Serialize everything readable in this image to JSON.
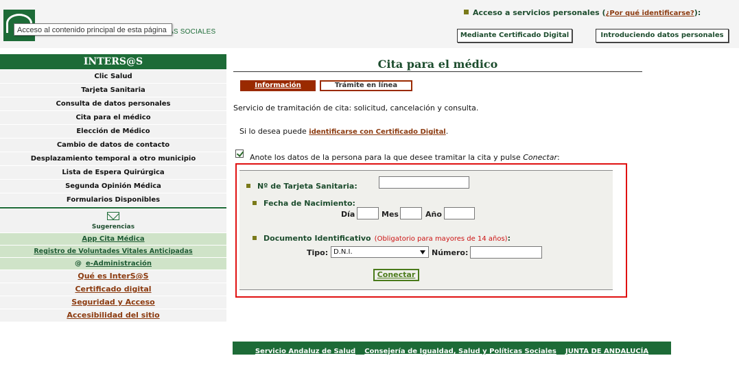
{
  "header": {
    "logo_text": "AS SOCIALES",
    "tooltip": "Acceso al contenido principal de esta página",
    "access_text": "Acceso a servicios personales",
    "access_link": "¿Por qué identificarse?",
    "access_paren_open": "(",
    "access_paren_close": "):",
    "btn_cert": "Mediante Certificado Digital",
    "btn_datos": "Introduciendo datos personales"
  },
  "sidebar": {
    "title": "INTERS@S",
    "items": [
      "Clic Salud",
      "Tarjeta Sanitaria",
      "Consulta de datos personales",
      "Cita para el médico",
      "Elección de Médico",
      "Cambio de datos de contacto",
      "Desplazamiento temporal a otro municipio",
      "Lista de Espera Quirúrgica",
      "Segunda Opinión Médica",
      "Formularios Disponibles"
    ],
    "sugerencias": "Sugerencias",
    "green_items": [
      "App Cita Médica",
      "Registro de Voluntades Vitales Anticipadas"
    ],
    "eadmin_at": "@",
    "eadmin": "e-Administración",
    "brown_items": [
      "Qué es InterS@S",
      "Certificado digital",
      "Seguridad y Acceso",
      "Accesibilidad del sitio"
    ]
  },
  "main": {
    "title": "Cita para el médico",
    "tab_info": "Información",
    "tab_tramite": "Trámite en línea",
    "description": "Servicio de tramitación de cita: solicitud, cancelación y consulta.",
    "ident_prefix": "Si lo desea puede",
    "ident_link": "identificarse con Certificado Digital",
    "ident_suffix": ".",
    "note_prefix": "Anote los datos de la persona para la que desee tramitar la cita y pulse",
    "note_em": "Conectar",
    "note_suffix": ":"
  },
  "form": {
    "tarjeta_label": "Nº de Tarjeta Sanitaria:",
    "tarjeta_value": "",
    "fecha_label": "Fecha de Nacimiento:",
    "dia_label": "Día",
    "mes_label": "Mes",
    "anio_label": "Año",
    "doc_label": "Documento Identificativo",
    "doc_note": "(Obligatorio para mayores de 14 años)",
    "doc_colon": ":",
    "tipo_label": "Tipo:",
    "tipo_value": "D.N.I.",
    "numero_label": "Número:",
    "conectar": "Conectar"
  },
  "footer": {
    "links": [
      "Servicio Andaluz de Salud",
      "Consejería de Igualdad, Salud y Políticas Sociales",
      "JUNTA DE ANDALUCÍA"
    ]
  },
  "colors": {
    "brand_green": "#1d6b37",
    "accent_brown": "#8b3a0f",
    "highlight_red": "#e01010"
  }
}
